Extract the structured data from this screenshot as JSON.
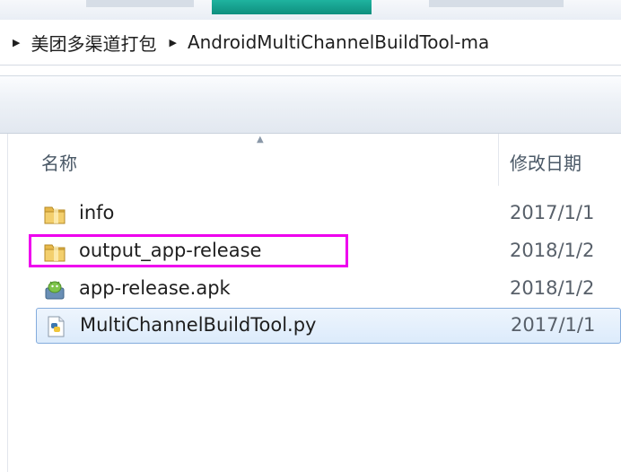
{
  "breadcrumb": {
    "items": [
      "美团多渠道打包",
      "AndroidMultiChannelBuildTool-ma"
    ]
  },
  "columns": {
    "name": "名称",
    "date_modified": "修改日期"
  },
  "files": [
    {
      "name": "info",
      "date": "2017/1/1",
      "icon": "folder-icon"
    },
    {
      "name": "output_app-release",
      "date": "2018/1/2",
      "icon": "folder-icon"
    },
    {
      "name": "app-release.apk",
      "date": "2018/1/2",
      "icon": "apk-file-icon"
    },
    {
      "name": "MultiChannelBuildTool.py",
      "date": "2017/1/1",
      "icon": "python-file-icon"
    }
  ],
  "colors": {
    "highlight": "#ee00ee",
    "selection_border": "#84acdd",
    "selection_fill": "#dcebfb",
    "folder": "#e7b84a"
  }
}
